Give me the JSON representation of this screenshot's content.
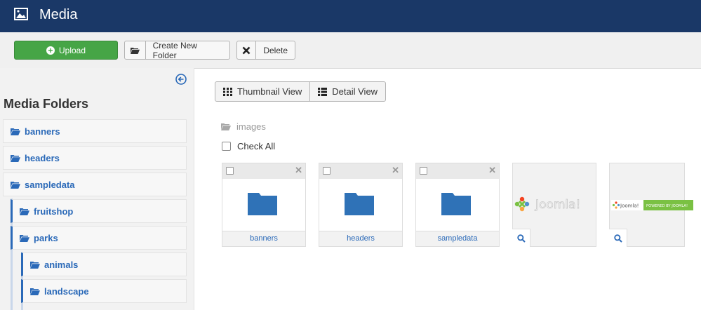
{
  "header": {
    "title": "Media"
  },
  "toolbar": {
    "upload_label": "Upload",
    "new_folder_label": "Create New Folder",
    "delete_label": "Delete"
  },
  "sidebar": {
    "title": "Media Folders",
    "folders": [
      {
        "label": "banners",
        "level": 0
      },
      {
        "label": "headers",
        "level": 0
      },
      {
        "label": "sampledata",
        "level": 0
      },
      {
        "label": "fruitshop",
        "level": 1
      },
      {
        "label": "parks",
        "level": 1
      },
      {
        "label": "animals",
        "level": 2
      },
      {
        "label": "landscape",
        "level": 2
      }
    ]
  },
  "main": {
    "views": [
      {
        "label": "Thumbnail View",
        "icon": "grid-icon"
      },
      {
        "label": "Detail View",
        "icon": "list-icon"
      }
    ],
    "breadcrumb": "images",
    "check_all": "Check All",
    "items": [
      {
        "type": "folder",
        "label": "banners"
      },
      {
        "type": "folder",
        "label": "headers"
      },
      {
        "type": "folder",
        "label": "sampledata"
      },
      {
        "type": "image",
        "label": "Joomla!"
      },
      {
        "type": "image",
        "label": "POWERED BY JOOMLA!"
      }
    ]
  },
  "colors": {
    "header_bg": "#1a3867",
    "upload_green": "#46a546",
    "link_blue": "#2a69b8",
    "folder_blue": "#2f72b7",
    "tree_line": "#2a69b8"
  }
}
